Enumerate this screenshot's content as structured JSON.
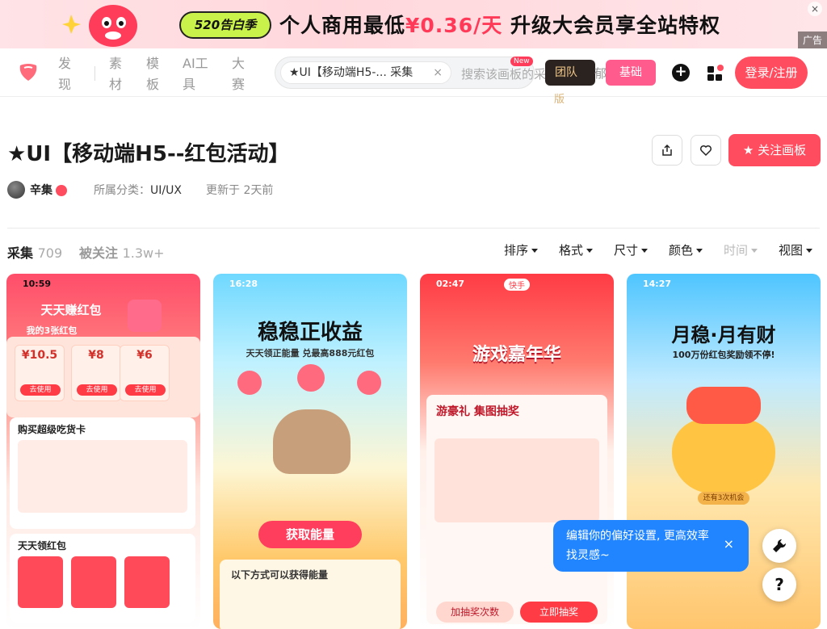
{
  "banner": {
    "badge": "520告白季",
    "headline_pre": "个人商用最低",
    "headline_price": "¥0.36/天",
    "headline_post": " 升级大会员享全站特权",
    "ad_label": "广告",
    "close_icon": "×"
  },
  "nav": {
    "items": [
      "发现",
      "素材",
      "模板",
      "AI工具",
      "大赛"
    ],
    "search_chip": "★UI【移动端H5-... 采集",
    "search_placeholder": "搜索该画板的采集",
    "new_tag": "New",
    "team_label": "团队",
    "team_sub": "版",
    "team_suffix": "郁",
    "basic_label": "基础",
    "login_label": "登录/注册"
  },
  "board": {
    "title": "★UI【移动端H5--红包活动】",
    "author": "辛集",
    "category_label": "所属分类：",
    "category_value": "UI/UX",
    "updated": "更新于 2天前",
    "follow_label": "关注画板"
  },
  "stats": {
    "pins_label": "采集",
    "pins_count": "709",
    "followers_label": "被关注",
    "followers_count": "1.3w+"
  },
  "filters": [
    {
      "label": "排序",
      "disabled": false
    },
    {
      "label": "格式",
      "disabled": false
    },
    {
      "label": "尺寸",
      "disabled": false
    },
    {
      "label": "颜色",
      "disabled": false
    },
    {
      "label": "时间",
      "disabled": true
    },
    {
      "label": "视图",
      "disabled": false
    }
  ],
  "cards": [
    {
      "time": "10:59",
      "headline": "天天赚红包",
      "sub": "我的3张红包",
      "section": "购买超级吃货卡",
      "section2": "天天领红包",
      "packs": [
        "¥10.5",
        "¥8",
        "¥6"
      ],
      "pack_btn": "去使用"
    },
    {
      "time": "16:28",
      "headline": "稳稳正收益",
      "sub": "天天领正能量 兑最高888元红包",
      "cta": "获取能量",
      "footer": "以下方式可以获得能量"
    },
    {
      "time": "02:47",
      "brand": "快手",
      "headline": "游戏嘉年华",
      "section": "游豪礼 集图抽奖",
      "cta1": "加抽奖次数",
      "cta2": "立即抽奖"
    },
    {
      "time": "14:27",
      "headline": "月稳·月有财",
      "sub": "100万份红包奖励领不停!",
      "cta": "还有3次机会"
    }
  ],
  "toast": {
    "text": "编辑你的偏好设置, 更高效率找灵感~",
    "close": "×"
  },
  "fabs": {
    "tool_icon": "wrench-icon",
    "help_label": "?"
  },
  "colors": {
    "brand": "#ff4d5f",
    "toast": "#2185ff"
  }
}
